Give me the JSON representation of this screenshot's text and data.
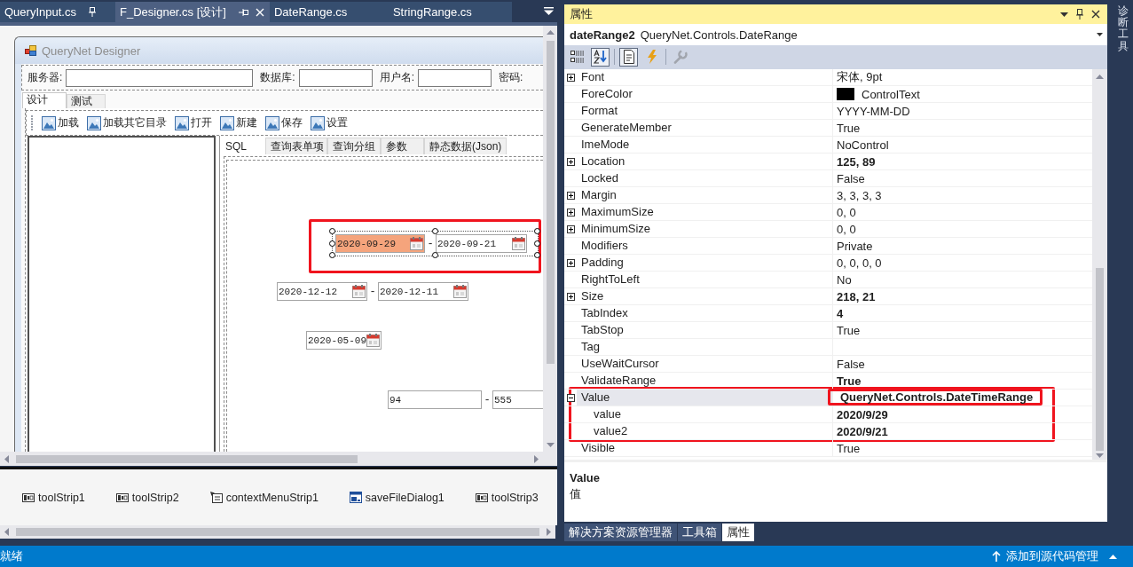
{
  "doc_tabs": [
    {
      "label": "QueryInput.cs",
      "selected": false,
      "pin_button": true,
      "pinned": true,
      "close_button": false
    },
    {
      "label": "F_Designer.cs [设计]",
      "selected": true,
      "pin_button": true,
      "pinned": false,
      "close_button": true
    },
    {
      "label": "DateRange.cs",
      "selected": false,
      "pin_button": false,
      "close_button": false
    },
    {
      "label": "StringRange.cs",
      "selected": false,
      "pin_button": false,
      "close_button": false
    }
  ],
  "designer": {
    "form_title": "QueryNet Designer",
    "connection_fields": [
      {
        "kind": "input",
        "label": "服务器:"
      },
      {
        "kind": "input",
        "label": "数据库:"
      },
      {
        "kind": "input",
        "label": "用户名:"
      },
      {
        "kind": "label",
        "label": "密码:"
      }
    ],
    "tabs": [
      {
        "label": "设计",
        "selected": true
      },
      {
        "label": "测试",
        "selected": false
      }
    ],
    "toolbar": [
      {
        "label": "加载"
      },
      {
        "label": "加载其它目录"
      },
      {
        "label": "打开"
      },
      {
        "label": "新建"
      },
      {
        "label": "保存"
      },
      {
        "label": "设置"
      }
    ],
    "query_tabs": [
      {
        "label": "SQL",
        "selected": true
      },
      {
        "label": "查询表单项",
        "selected": false
      },
      {
        "label": "查询分组",
        "selected": false
      },
      {
        "label": "参数",
        "selected": false
      },
      {
        "label": "静态数据(Json)",
        "selected": false
      }
    ],
    "controls": [
      {
        "kind": "date_range",
        "selected": true,
        "highlighted": true,
        "separator": "-",
        "fields": [
          {
            "text": "2020-09-29",
            "invalid": true
          },
          {
            "text": "2020-09-21",
            "invalid": false
          }
        ]
      },
      {
        "kind": "date_range",
        "selected": false,
        "highlighted": false,
        "separator": "-",
        "fields": [
          {
            "text": "2020-12-12",
            "invalid": false
          },
          {
            "text": "2020-12-11",
            "invalid": false
          }
        ]
      },
      {
        "kind": "date",
        "selected": false,
        "highlighted": false,
        "fields": [
          {
            "text": "2020-05-09",
            "invalid": false
          }
        ]
      },
      {
        "kind": "number_range",
        "selected": false,
        "highlighted": false,
        "separator": "-",
        "fields": [
          {
            "text": "94",
            "invalid": false
          },
          {
            "text": "555",
            "invalid": false
          }
        ]
      }
    ],
    "tray": [
      {
        "kind": "toolstrip",
        "label": "toolStrip1"
      },
      {
        "kind": "toolstrip",
        "label": "toolStrip2"
      },
      {
        "kind": "context_menu",
        "label": "contextMenuStrip1"
      },
      {
        "kind": "dialog",
        "label": "saveFileDialog1"
      },
      {
        "kind": "toolstrip",
        "label": "toolStrip3"
      }
    ]
  },
  "properties": {
    "title": "属性",
    "object_name": "dateRange2",
    "object_type": "QueryNet.Controls.DateRange",
    "toolbar": [
      {
        "kind": "categorized",
        "selected": false,
        "disabled": false
      },
      {
        "kind": "alphabetical",
        "selected": true,
        "disabled": false
      },
      {
        "kind": "property_pages",
        "selected": true,
        "disabled": false
      },
      {
        "kind": "events",
        "selected": false,
        "disabled": false
      },
      {
        "kind": "wrench",
        "selected": false,
        "disabled": true
      }
    ],
    "rows": [
      {
        "name": "Font",
        "value": "宋体, 9pt",
        "modified": false,
        "expandable": true,
        "expanded": false,
        "selected": false,
        "highlighted": false
      },
      {
        "name": "ForeColor",
        "value": "ControlText",
        "color": "#000000",
        "modified": false,
        "expandable": false,
        "selected": false,
        "highlighted": false
      },
      {
        "name": "Format",
        "value": "YYYY-MM-DD",
        "modified": false,
        "expandable": false,
        "selected": false,
        "highlighted": false
      },
      {
        "name": "GenerateMember",
        "value": "True",
        "modified": false,
        "expandable": false,
        "selected": false,
        "highlighted": false
      },
      {
        "name": "ImeMode",
        "value": "NoControl",
        "modified": false,
        "expandable": false,
        "selected": false,
        "highlighted": false
      },
      {
        "name": "Location",
        "value": "125, 89",
        "modified": true,
        "expandable": true,
        "expanded": false,
        "selected": false,
        "highlighted": false
      },
      {
        "name": "Locked",
        "value": "False",
        "modified": false,
        "expandable": false,
        "selected": false,
        "highlighted": false
      },
      {
        "name": "Margin",
        "value": "3, 3, 3, 3",
        "modified": false,
        "expandable": true,
        "expanded": false,
        "selected": false,
        "highlighted": false
      },
      {
        "name": "MaximumSize",
        "value": "0, 0",
        "modified": false,
        "expandable": true,
        "expanded": false,
        "selected": false,
        "highlighted": false
      },
      {
        "name": "MinimumSize",
        "value": "0, 0",
        "modified": false,
        "expandable": true,
        "expanded": false,
        "selected": false,
        "highlighted": false
      },
      {
        "name": "Modifiers",
        "value": "Private",
        "modified": false,
        "expandable": false,
        "selected": false,
        "highlighted": false
      },
      {
        "name": "Padding",
        "value": "0, 0, 0, 0",
        "modified": false,
        "expandable": true,
        "expanded": false,
        "selected": false,
        "highlighted": false
      },
      {
        "name": "RightToLeft",
        "value": "No",
        "modified": false,
        "expandable": false,
        "selected": false,
        "highlighted": false
      },
      {
        "name": "Size",
        "value": "218, 21",
        "modified": true,
        "expandable": true,
        "expanded": false,
        "selected": false,
        "highlighted": false
      },
      {
        "name": "TabIndex",
        "value": "4",
        "modified": true,
        "expandable": false,
        "selected": false,
        "highlighted": false
      },
      {
        "name": "TabStop",
        "value": "True",
        "modified": false,
        "expandable": false,
        "selected": false,
        "highlighted": false
      },
      {
        "name": "Tag",
        "expandable": false,
        "selected": false,
        "highlighted": false
      },
      {
        "name": "UseWaitCursor",
        "value": "False",
        "modified": false,
        "expandable": false,
        "selected": false,
        "highlighted": false
      },
      {
        "name": "ValidateRange",
        "value": "True",
        "modified": true,
        "expandable": false,
        "selected": false,
        "highlighted": false
      },
      {
        "name": "Value",
        "value": "QueryNet.Controls.DateTimeRange",
        "modified": true,
        "expandable": true,
        "expanded": true,
        "selected": true,
        "highlighted": true,
        "children": [
          {
            "name": "value",
            "value": "2020/9/29",
            "modified": true,
            "expandable": false,
            "selected": false
          },
          {
            "name": "value2",
            "value": "2020/9/21",
            "modified": true,
            "expandable": false,
            "selected": false
          }
        ]
      },
      {
        "name": "Visible",
        "value": "True",
        "modified": false,
        "expandable": false,
        "selected": false,
        "highlighted": false
      }
    ],
    "description": {
      "title": "Value",
      "text": "值"
    }
  },
  "bottom_tabs": [
    {
      "label": "解决方案资源管理器",
      "selected": false
    },
    {
      "label": "工具箱",
      "selected": false
    },
    {
      "label": "属性",
      "selected": true
    }
  ],
  "side_tab": {
    "label": "诊断工具"
  },
  "status_bar": {
    "text": "就绪",
    "source_control": "添加到源代码管理"
  }
}
